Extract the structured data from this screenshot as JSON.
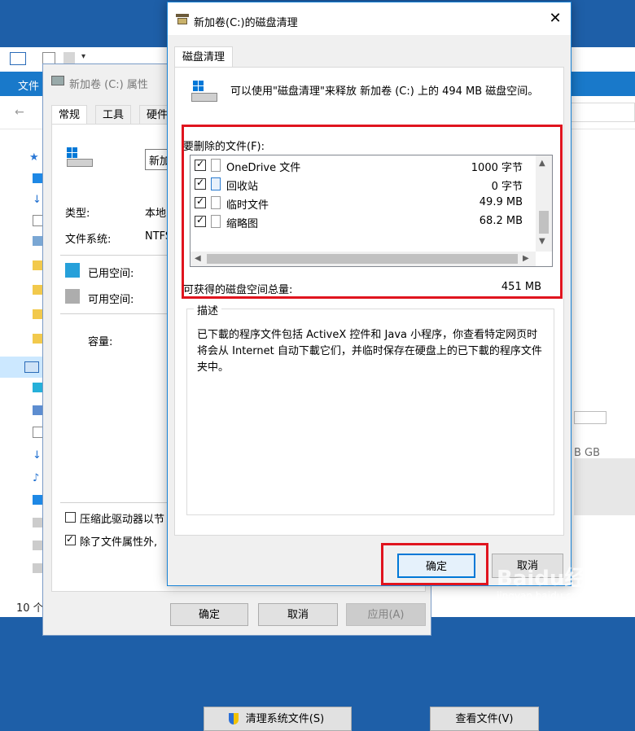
{
  "explorer": {
    "ribbon_file": "文件",
    "status_count": "10 个",
    "right_size_text": "B GB"
  },
  "properties": {
    "title": "新加卷 (C:) 属性",
    "tabs": [
      "常规",
      "工具",
      "硬件"
    ],
    "name_value": "新加",
    "type_label": "类型:",
    "type_value": "本地",
    "fs_label": "文件系统:",
    "fs_value": "NTFS",
    "used_label": "已用空间:",
    "free_label": "可用空间:",
    "capacity_label": "容量:",
    "compress_label": "压缩此驱动器以节",
    "index_label": "除了文件属性外,",
    "ok": "确定",
    "cancel": "取消",
    "apply": "应用(A)",
    "colors": {
      "used": "#26a0da",
      "free": "#adadad"
    }
  },
  "dialog": {
    "title": "新加卷(C:)的磁盘清理",
    "close_glyph": "✕",
    "tab": "磁盘清理",
    "info_text": "可以使用\"磁盘清理\"来释放 新加卷 (C:) 上的 494 MB 磁盘空间。",
    "files_label": "要删除的文件(F):",
    "files": [
      {
        "name": "OneDrive 文件",
        "size": "1000 字节",
        "checked": true
      },
      {
        "name": "回收站",
        "size": "0 字节",
        "checked": true
      },
      {
        "name": "临时文件",
        "size": "49.9 MB",
        "checked": true
      },
      {
        "name": "缩略图",
        "size": "68.2 MB",
        "checked": true
      }
    ],
    "total_label": "可获得的磁盘空间总量:",
    "total_value": "451 MB",
    "desc_legend": "描述",
    "desc_text": "已下載的程序文件包括 ActiveX 控件和 Java 小程序，你查看特定网页时将会从 Internet 自动下載它们，并临时保存在硬盘上的已下載的程序文件夹中。",
    "clean_system_button": "清理系统文件(S)",
    "view_files_button": "查看文件(V)",
    "ok": "确定",
    "cancel": "取消",
    "highlight_color": "#e0141e"
  },
  "watermark": {
    "brand": "Baidu经验",
    "url": "jingyan.baidu.com"
  }
}
